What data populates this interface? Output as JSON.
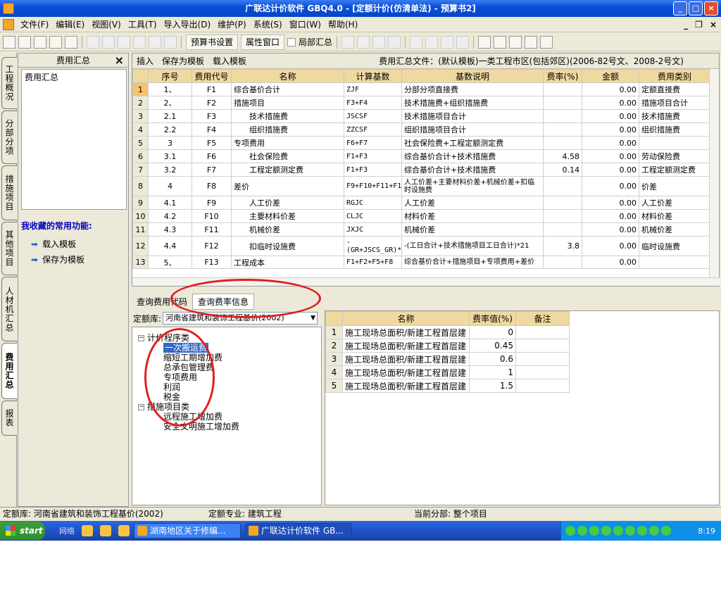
{
  "window": {
    "title": "广联达计价软件 GBQ4.0 - [定额计价(仿清单法) - 预算书2]"
  },
  "menu": [
    "文件(F)",
    "编辑(E)",
    "视图(V)",
    "工具(T)",
    "导入导出(D)",
    "维护(P)",
    "系统(S)",
    "窗口(W)",
    "帮助(H)"
  ],
  "mdi_controls": [
    "_",
    "❐",
    "×"
  ],
  "toolbar": {
    "budget_settings": "预算书设置",
    "property_window": "属性窗口",
    "local_summary": "局部汇总"
  },
  "vtabs": [
    "工程概况",
    "分部分项",
    "措施项目",
    "其他项目",
    "人材机汇总",
    "费用汇总",
    "报表"
  ],
  "left_panel": {
    "header": "费用汇总",
    "tree_item": "费用汇总",
    "fav_title": "我收藏的常用功能:",
    "fav_items": [
      "载入模板",
      "保存为模板"
    ]
  },
  "grid_toolbar": {
    "insert": "插入",
    "save_template": "保存为模板",
    "load_template": "载入模板",
    "file_label": "费用汇总文件：(默认模板)一类工程市区(包括郊区)(2006-82号文、2008-2号文)"
  },
  "fee_table": {
    "headers": [
      "序号",
      "费用代号",
      "名称",
      "计算基数",
      "基数说明",
      "费率(%)",
      "金额",
      "费用类别"
    ],
    "rows": [
      [
        "1",
        "1、",
        "F1",
        "综合基价合计",
        "ZJF",
        "分部分项直接费",
        "",
        "0.00",
        "定额直接费"
      ],
      [
        "2",
        "2、",
        "F2",
        "措施项目",
        "F3+F4",
        "技术措施费+组织措施费",
        "",
        "0.00",
        "措施项目合计"
      ],
      [
        "3",
        "2.1",
        "F3",
        "　　技术措施费",
        "JSCSF",
        "技术措施项目合计",
        "",
        "0.00",
        "技术措施费"
      ],
      [
        "4",
        "2.2",
        "F4",
        "　　组织措施费",
        "ZZCSF",
        "组织措施项目合计",
        "",
        "0.00",
        "组织措施费"
      ],
      [
        "5",
        "3",
        "F5",
        "专项费用",
        "F6+F7",
        "社会保险费+工程定额测定费",
        "",
        "0.00",
        ""
      ],
      [
        "6",
        "3.1",
        "F6",
        "　　社会保险费",
        "F1+F3",
        "综合基价合计+技术措施费",
        "4.58",
        "0.00",
        "劳动保险费"
      ],
      [
        "7",
        "3.2",
        "F7",
        "　　工程定额测定费",
        "F1+F3",
        "综合基价合计+技术措施费",
        "0.14",
        "0.00",
        "工程定额测定费"
      ],
      [
        "8",
        "4",
        "F8",
        "差价",
        "F9+F10+F11+F12",
        "人工价差+主要材料价差+机械价差+扣临时设施费",
        "",
        "0.00",
        "价差"
      ],
      [
        "9",
        "4.1",
        "F9",
        "　　人工价差",
        "RGJC",
        "人工价差",
        "",
        "0.00",
        "人工价差"
      ],
      [
        "10",
        "4.2",
        "F10",
        "　　主要材料价差",
        "CLJC",
        "材料价差",
        "",
        "0.00",
        "材料价差"
      ],
      [
        "11",
        "4.3",
        "F11",
        "　　机械价差",
        "JXJC",
        "机械价差",
        "",
        "0.00",
        "机械价差"
      ],
      [
        "12",
        "4.4",
        "F12",
        "　　扣临时设施费",
        "-(GR+JSCS_GR)*21",
        "-(工日合计+技术措施项目工日合计)*21",
        "3.8",
        "0.00",
        "临时设施费"
      ],
      [
        "13",
        "5、",
        "F13",
        "工程成本",
        "F1+F2+F5+F8",
        "综合基价合计+措施项目+专项费用+差价",
        "",
        "0.00",
        ""
      ]
    ]
  },
  "bottom_tabs": [
    "查询费用代码",
    "查询费率信息"
  ],
  "quota": {
    "label": "定额库:",
    "value": "河南省建筑和装饰工程基价(2002)"
  },
  "tree": {
    "group1": "计价程序类",
    "group1_items": [
      "一次搬运费",
      "缩短工期增加费",
      "总承包管理费",
      "专项费用",
      "利润",
      "税金"
    ],
    "group2": "措施项目类",
    "group2_items": [
      "远程施工增加费",
      "安全文明施工增加费"
    ]
  },
  "rate_table": {
    "headers": [
      "名称",
      "费率值(%)",
      "备注"
    ],
    "rows": [
      [
        "1",
        "施工现场总面积/新建工程首层建",
        "0",
        ""
      ],
      [
        "2",
        "施工现场总面积/新建工程首层建",
        "0.45",
        ""
      ],
      [
        "3",
        "施工现场总面积/新建工程首层建",
        "0.6",
        ""
      ],
      [
        "4",
        "施工现场总面积/新建工程首层建",
        "1",
        ""
      ],
      [
        "5",
        "施工现场总面积/新建工程首层建",
        "1.5",
        ""
      ]
    ]
  },
  "status": {
    "quota": "定额库: 河南省建筑和装饰工程基价(2002)",
    "major": "定额专业: 建筑工程",
    "section": "当前分部: 整个项目"
  },
  "taskbar": {
    "start": "start",
    "ql": "网络",
    "tasks": [
      "湖南地区关于修编...",
      "广联达计价软件 GB..."
    ],
    "clock": "8:19"
  },
  "annotation_color": "#e02020"
}
